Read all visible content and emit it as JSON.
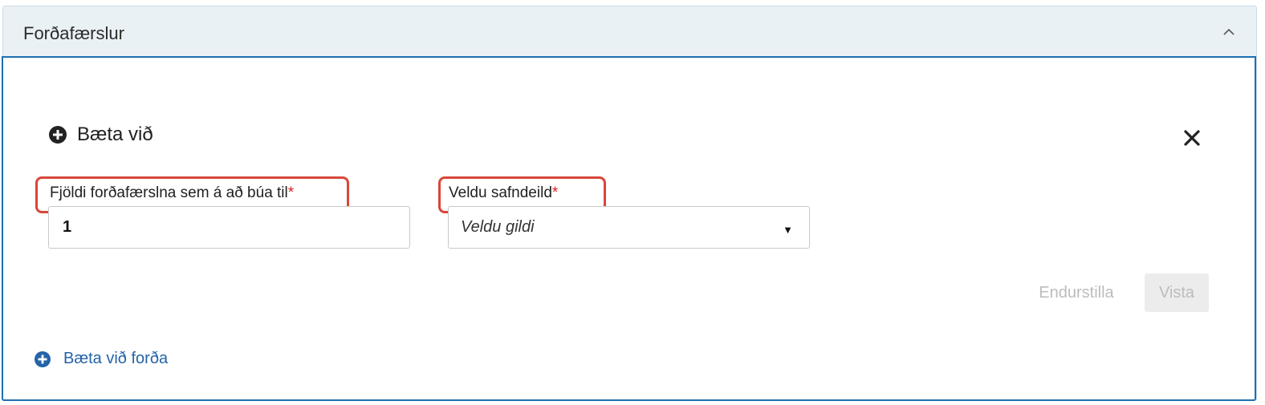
{
  "panel": {
    "title": "Forðafærslur"
  },
  "form": {
    "add_heading": "Bæta við",
    "count_field": {
      "label": "Fjöldi forðafærslna sem á að búa til",
      "required_marker": "*",
      "value": "1"
    },
    "department_field": {
      "label": "Veldu safndeild",
      "required_marker": "*",
      "selected": "Veldu gildi"
    },
    "reset_label": "Endurstilla",
    "save_label": "Vista"
  },
  "add_link": {
    "label": "Bæta við forða"
  },
  "icons": {
    "collapse": "chevron-up-icon",
    "close": "close-icon",
    "add_heading": "plus-circle-icon",
    "add_link": "plus-circle-icon"
  },
  "colors": {
    "header_bg": "#eaf1f5",
    "focus_border": "#1e6fb0",
    "required": "#e0201e",
    "highlight": "#d9473a",
    "link": "#2463a8"
  }
}
